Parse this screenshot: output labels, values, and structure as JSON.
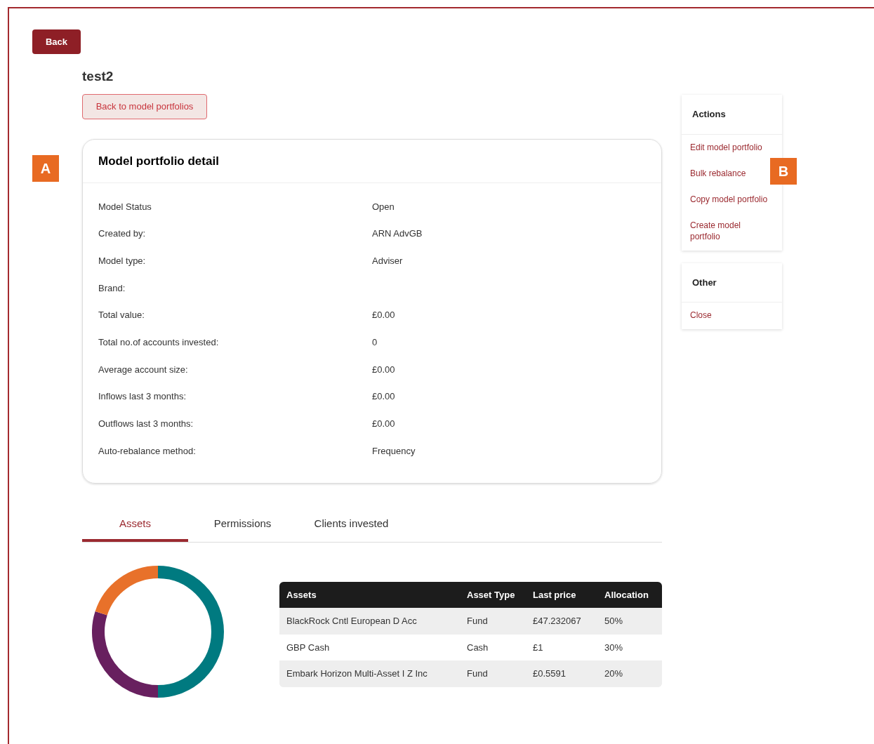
{
  "back_button": "Back",
  "title": "test2",
  "back_link": "Back to model portfolios",
  "callouts": [
    {
      "label": "A"
    },
    {
      "label": "B"
    }
  ],
  "detail": {
    "title": "Model portfolio detail",
    "rows": [
      {
        "label": "Model Status",
        "value": "Open"
      },
      {
        "label": "Created by:",
        "value": "ARN AdvGB"
      },
      {
        "label": "Model type:",
        "value": "Adviser"
      },
      {
        "label": "Brand:",
        "value": ""
      },
      {
        "label": "Total value:",
        "value": "£0.00"
      },
      {
        "label": "Total no.of accounts invested:",
        "value": "0"
      },
      {
        "label": "Average account size:",
        "value": "£0.00"
      },
      {
        "label": "Inflows last 3 months:",
        "value": "£0.00"
      },
      {
        "label": "Outflows last 3 months:",
        "value": "£0.00"
      },
      {
        "label": "Auto-rebalance method:",
        "value": "Frequency"
      }
    ]
  },
  "tabs": [
    {
      "label": "Assets",
      "selected": true
    },
    {
      "label": "Permissions",
      "selected": false
    },
    {
      "label": "Clients invested",
      "selected": false
    }
  ],
  "assets_table": {
    "columns": [
      "Assets",
      "Asset Type",
      "Last price",
      "Allocation"
    ],
    "rows": [
      {
        "cells": [
          "BlackRock Cntl European D Acc",
          "Fund",
          "£47.232067",
          "50%"
        ],
        "color": "#007a80"
      },
      {
        "cells": [
          "GBP Cash",
          "Cash",
          "£1",
          "30%"
        ],
        "color": "#68205f"
      },
      {
        "cells": [
          "Embark Horizon Multi-Asset I Z Inc",
          "Fund",
          "£0.5591",
          "20%"
        ],
        "color": "#e8712a"
      }
    ]
  },
  "sidebar": [
    {
      "title": "Actions",
      "items": [
        "Edit model portfolio",
        "Bulk rebalance",
        "Copy model portfolio",
        "Create model portfolio"
      ]
    },
    {
      "title": "Other",
      "items": [
        "Close"
      ]
    }
  ]
}
